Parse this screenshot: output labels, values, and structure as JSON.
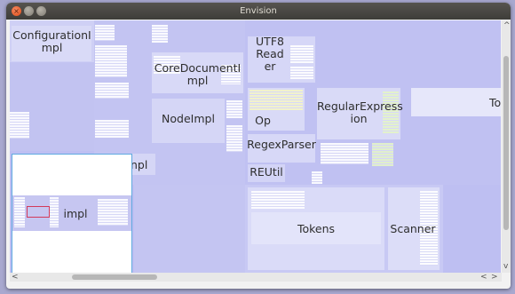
{
  "window": {
    "title": "Envision"
  },
  "controls": {
    "close": "×"
  },
  "treemap": {
    "labels": {
      "configurationimpl": "ConfigurationI\nmpl",
      "coredocumentimpl": "CoreDocumentI\nmpl",
      "nodeimpl": "NodeImpl",
      "utf8reader": "UTF8\nRead\ner",
      "op": "Op",
      "regularexpression": "RegularExpress\nion",
      "regexparser": "RegexParser",
      "reutil": "REUtil",
      "tokens": "Tokens",
      "scanner": "Scanner",
      "to_partial": "To",
      "impl_partial": "npl",
      "minimap_impl": "impl"
    }
  },
  "scrollbars": {
    "up": "^",
    "down": "v",
    "left": "<",
    "right": ">"
  }
}
